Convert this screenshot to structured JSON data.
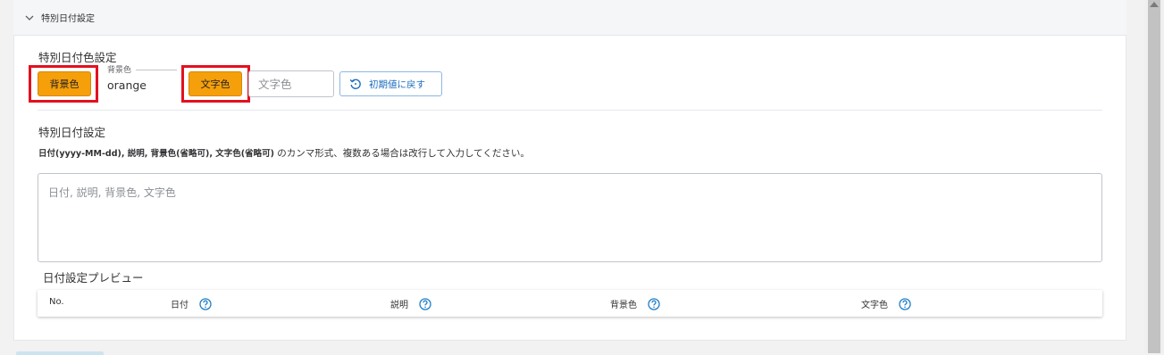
{
  "accordion": {
    "title": "特別日付設定"
  },
  "color_settings": {
    "section_title": "特別日付色設定",
    "bg_button_label": "背景色",
    "bg_field_label": "背景色",
    "bg_field_value": "orange",
    "text_button_label": "文字色",
    "text_field_placeholder": "文字色",
    "reset_button_label": "初期値に戻す",
    "button_color": "#f59f0b",
    "highlight_color": "#e3101f"
  },
  "date_settings": {
    "section_title": "特別日付設定",
    "hint_bold": "日付(yyyy-MM-dd), 説明, 背景色(省略可), 文字色(省略可)",
    "hint_rest": " のカンマ形式、複数ある場合は改行して入力してください。",
    "textarea_placeholder": "日付, 説明, 背景色, 文字色"
  },
  "preview": {
    "title": "日付設定プレビュー",
    "columns": [
      "No.",
      "日付",
      "説明",
      "背景色",
      "文字色"
    ]
  }
}
